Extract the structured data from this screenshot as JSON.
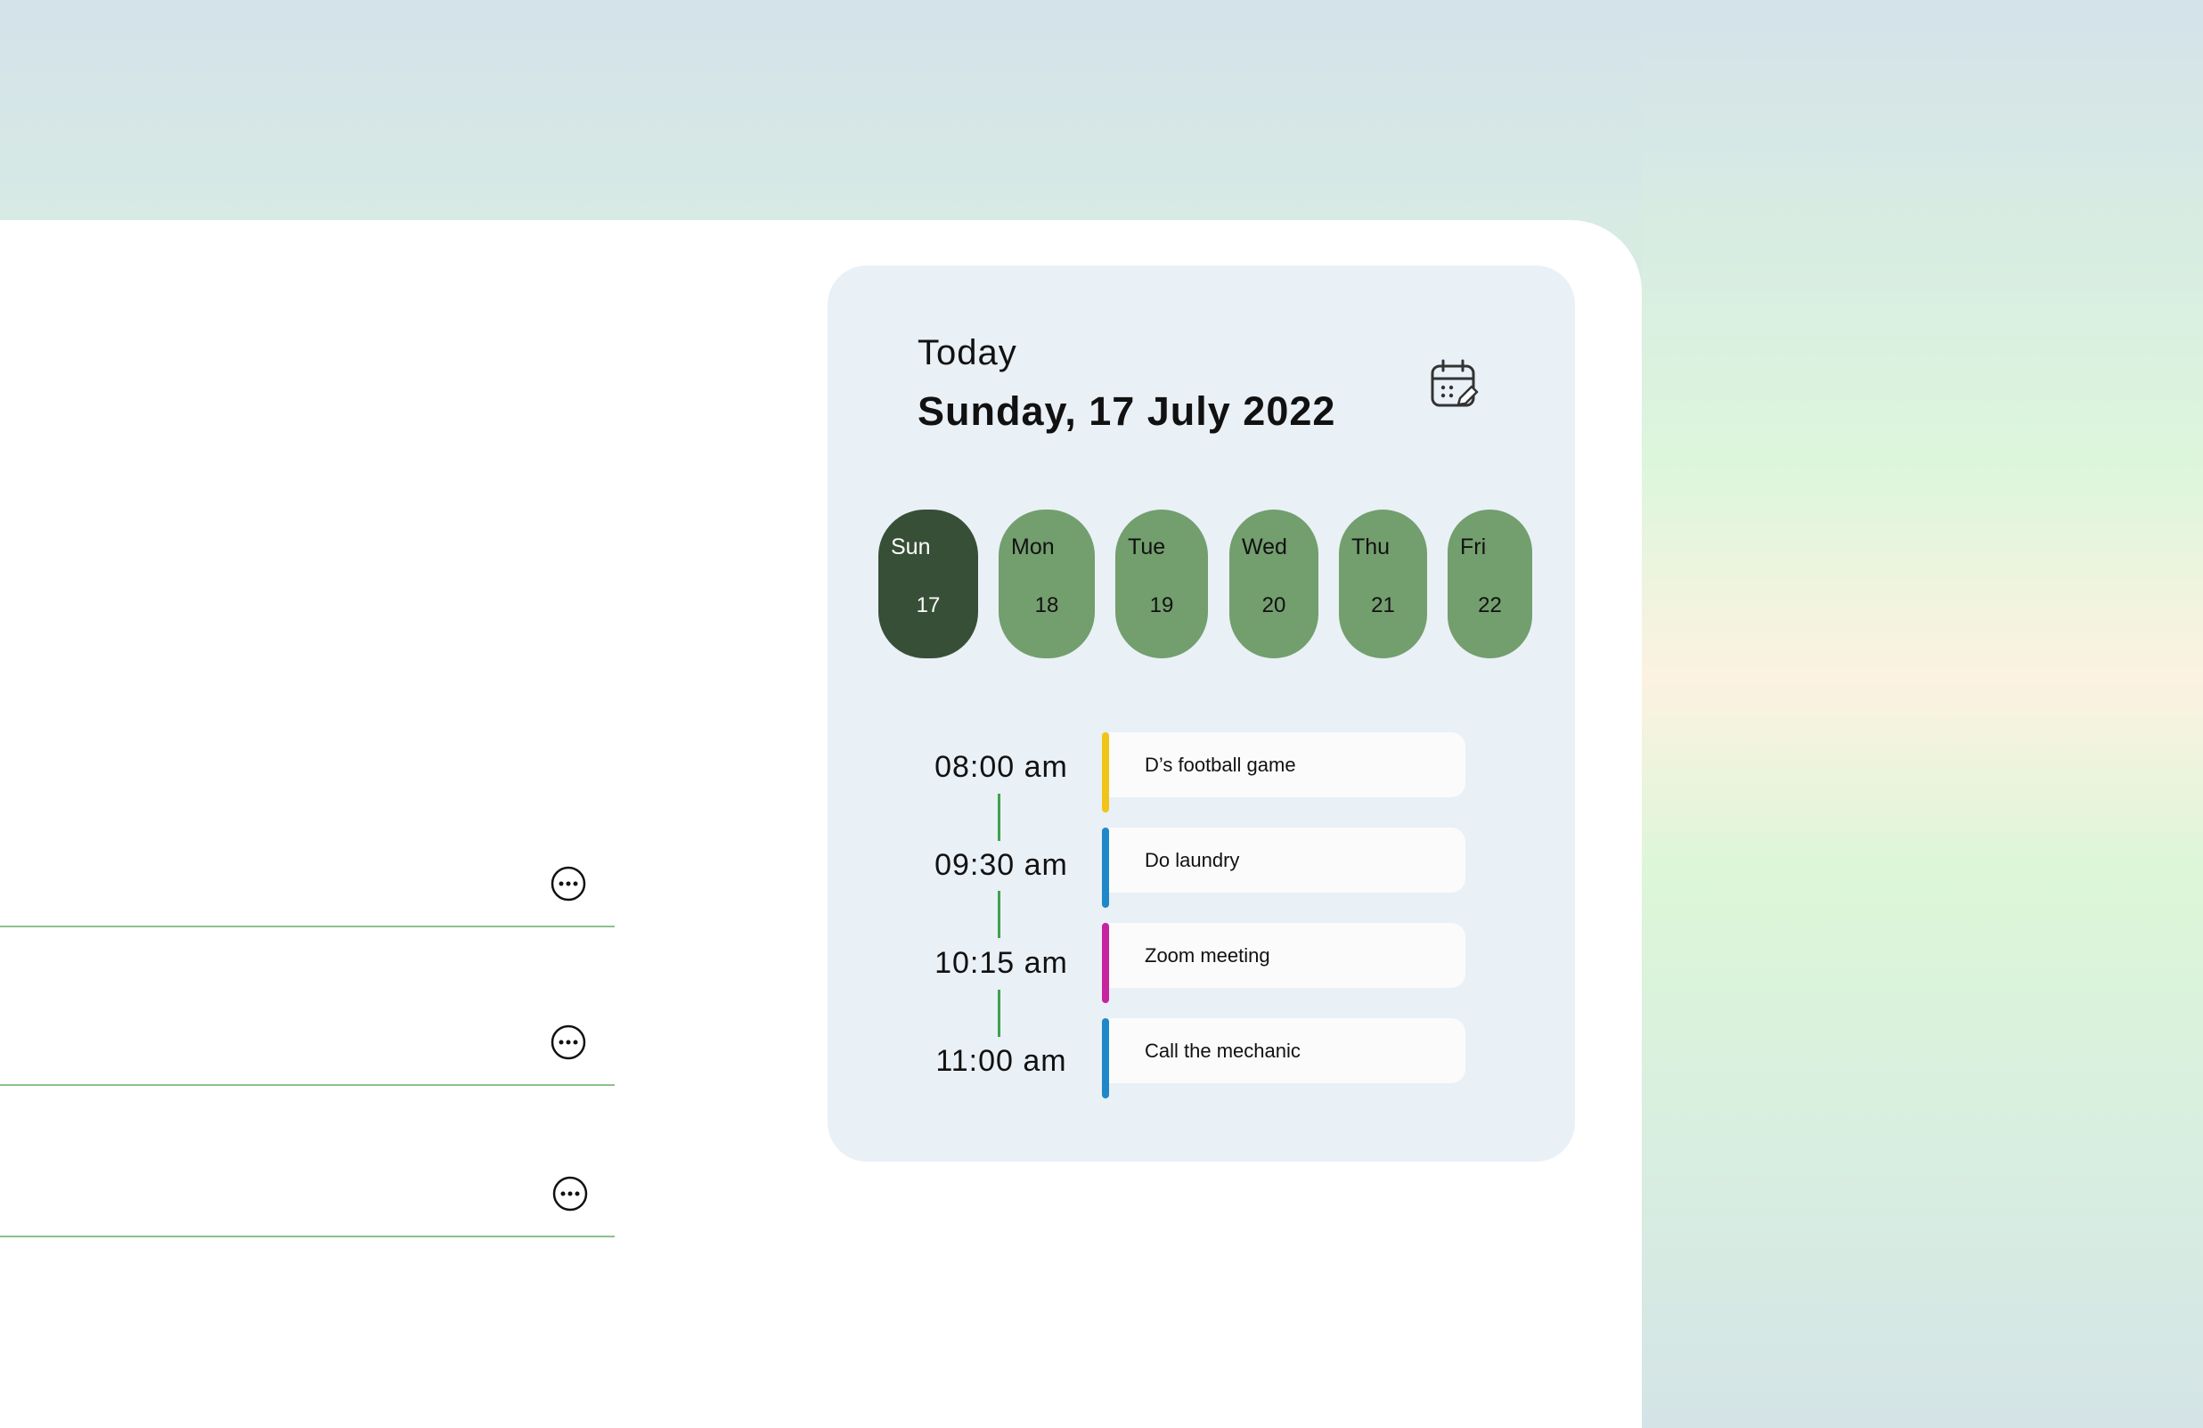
{
  "schedule": {
    "today_label": "Today",
    "date_title": "Sunday, 17 July 2022",
    "days": [
      {
        "name": "Sun",
        "num": "17",
        "active": true
      },
      {
        "name": "Mon",
        "num": "18",
        "active": false
      },
      {
        "name": "Tue",
        "num": "19",
        "active": false
      },
      {
        "name": "Wed",
        "num": "20",
        "active": false
      },
      {
        "name": "Thu",
        "num": "21",
        "active": false
      },
      {
        "name": "Fri",
        "num": "22",
        "active": false
      }
    ],
    "events": [
      {
        "time": "08:00 am",
        "title": "D’s football game",
        "color": "#f0c419"
      },
      {
        "time": "09:30 am",
        "title": "Do laundry",
        "color": "#1e88c8"
      },
      {
        "time": "10:15 am",
        "title": "Zoom meeting",
        "color": "#c7229f"
      },
      {
        "time": "11:00 am",
        "title": "Call the mechanic",
        "color": "#1e88c8"
      }
    ]
  },
  "icons": {
    "calendar": "calendar-edit-icon",
    "more": "more-options-icon"
  },
  "colors": {
    "active_day": "#384f37",
    "day": "#739e6e",
    "card": "#e9f0f6",
    "connector": "#3fa34a",
    "divider": "#8bc18b"
  }
}
